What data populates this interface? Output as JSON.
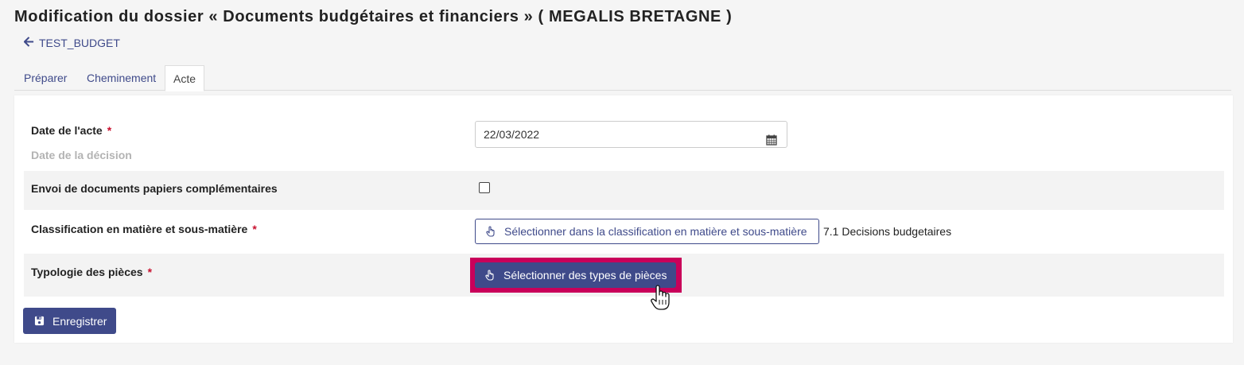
{
  "header": {
    "title": "Modification du dossier « Documents budgétaires et financiers » ( MEGALIS BRETAGNE )",
    "back_label": "TEST_BUDGET"
  },
  "tabs": [
    {
      "label": "Préparer",
      "active": false
    },
    {
      "label": "Cheminement",
      "active": false
    },
    {
      "label": "Acte",
      "active": true
    }
  ],
  "form": {
    "date_acte": {
      "label": "Date de l'acte",
      "required_mark": "*",
      "hint": "Date de la décision",
      "value": "22/03/2022"
    },
    "envoi_papiers": {
      "label": "Envoi de documents papiers complémentaires",
      "checked": false
    },
    "classification": {
      "label": "Classification en matière et sous-matière",
      "required_mark": "*",
      "button_label": "Sélectionner dans la classification en matière et sous-matière",
      "value": "7.1 Decisions budgetaires"
    },
    "typologie": {
      "label": "Typologie des pièces",
      "required_mark": "*",
      "button_label": "Sélectionner des types de pièces"
    }
  },
  "actions": {
    "save_label": "Enregistrer"
  },
  "colors": {
    "primary": "#3f4a8a",
    "highlight": "#c9005a",
    "required": "#c8102e"
  },
  "icons": {
    "back": "arrow-left-icon",
    "calendar": "calendar-icon",
    "select": "hand-pointer-icon",
    "save": "floppy-disk-icon",
    "cursor": "hand-cursor-icon"
  }
}
